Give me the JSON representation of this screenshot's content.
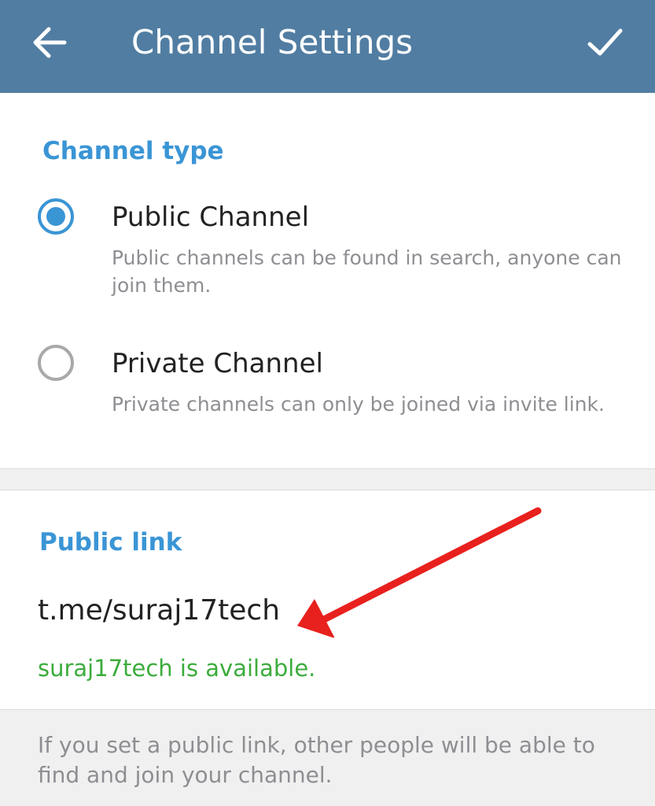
{
  "header": {
    "title": "Channel Settings",
    "back_icon": "arrow-left-icon",
    "done_icon": "checkmark-icon",
    "background_color": "#517da2"
  },
  "channel_type": {
    "heading": "Channel type",
    "options": [
      {
        "title": "Public Channel",
        "description": "Public channels can be found in search, anyone can join them.",
        "selected": true
      },
      {
        "title": "Private Channel",
        "description": "Private channels can only be joined via invite link.",
        "selected": false
      }
    ]
  },
  "public_link": {
    "heading": "Public link",
    "value": "t.me/suraj17tech",
    "status": "suraj17tech is available.",
    "status_color": "#3cac3c"
  },
  "footer": {
    "info": "If you set a public link, other people will be able to find and join your channel."
  },
  "annotation": {
    "icon": "red-arrow-icon",
    "color": "#e8211e"
  }
}
